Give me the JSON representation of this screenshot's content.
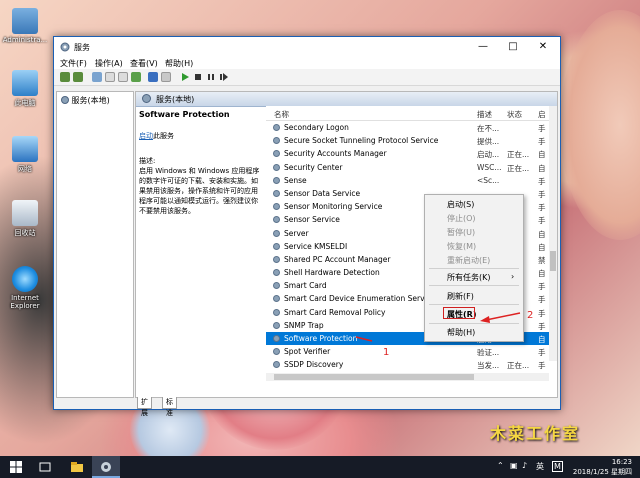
{
  "desktop": {
    "icons": [
      {
        "label": "Administra..."
      },
      {
        "label": "此电脑"
      },
      {
        "label": "网络"
      },
      {
        "label": "回收站"
      },
      {
        "label": "Internet Explorer"
      }
    ]
  },
  "window": {
    "title": "服务",
    "menu": [
      "文件(F)",
      "操作(A)",
      "查看(V)",
      "帮助(H)"
    ],
    "tree_root": "服务(本地)",
    "pane_title": "服务(本地)"
  },
  "details": {
    "service_name": "Software Protection",
    "start_link": "启动",
    "start_suffix": "此服务",
    "desc_label": "描述:",
    "desc_text": "启用 Windows 和 Windows 应用程序的数字许可证的下载、安装和实施。如果禁用该服务，操作系统和许可的应用程序可能以通知模式运行。强烈建议你不要禁用该服务。"
  },
  "columns": {
    "name": "名称",
    "desc": "描述",
    "status": "状态",
    "startup": "启"
  },
  "services": [
    {
      "name": "Secondary Logon",
      "desc": "在不...",
      "status": "",
      "startup": "手"
    },
    {
      "name": "Secure Socket Tunneling Protocol Service",
      "desc": "提供...",
      "status": "",
      "startup": "手"
    },
    {
      "name": "Security Accounts Manager",
      "desc": "启动...",
      "status": "正在...",
      "startup": "自"
    },
    {
      "name": "Security Center",
      "desc": "WSC...",
      "status": "正在...",
      "startup": "自"
    },
    {
      "name": "Sense",
      "desc": "<Sc...",
      "status": "",
      "startup": "手"
    },
    {
      "name": "Sensor Data Service",
      "desc": "",
      "status": "",
      "startup": "手"
    },
    {
      "name": "Sensor Monitoring Service",
      "desc": "",
      "status": "",
      "startup": "手"
    },
    {
      "name": "Sensor Service",
      "desc": "",
      "status": "",
      "startup": "手"
    },
    {
      "name": "Server",
      "desc": "",
      "status": "",
      "startup": "自"
    },
    {
      "name": "Service KMSELDI",
      "desc": "",
      "status": "",
      "startup": "自"
    },
    {
      "name": "Shared PC Account Manager",
      "desc": "",
      "status": "",
      "startup": "禁"
    },
    {
      "name": "Shell Hardware Detection",
      "desc": "",
      "status": "",
      "startup": "自"
    },
    {
      "name": "Smart Card",
      "desc": "",
      "status": "",
      "startup": "手"
    },
    {
      "name": "Smart Card Device Enumeration Service",
      "desc": "",
      "status": "",
      "startup": "手"
    },
    {
      "name": "Smart Card Removal Policy",
      "desc": "",
      "status": "",
      "startup": "手"
    },
    {
      "name": "SNMP Trap",
      "desc": "",
      "status": "",
      "startup": "手"
    },
    {
      "name": "Software Protection",
      "desc": "启用...",
      "status": "",
      "startup": "自"
    },
    {
      "name": "Spot Verifier",
      "desc": "验证...",
      "status": "",
      "startup": "手"
    },
    {
      "name": "SSDP Discovery",
      "desc": "当发...",
      "status": "正在...",
      "startup": "手"
    }
  ],
  "tabs": [
    "扩展",
    "标准"
  ],
  "context_menu": [
    {
      "label": "启动(S)",
      "enabled": true
    },
    {
      "label": "停止(O)",
      "enabled": false
    },
    {
      "label": "暂停(U)",
      "enabled": false
    },
    {
      "label": "恢复(M)",
      "enabled": false
    },
    {
      "label": "重新启动(E)",
      "enabled": false
    },
    {
      "label": "所有任务(K)",
      "enabled": true,
      "submenu": true
    },
    {
      "label": "刷新(F)",
      "enabled": true
    },
    {
      "label": "属性(R)",
      "enabled": true,
      "bold": true
    },
    {
      "label": "帮助(H)",
      "enabled": true
    }
  ],
  "annotations": {
    "one": "1",
    "two": "2"
  },
  "taskbar": {
    "time": "16:23",
    "date": "2018/1/25 星期四",
    "ime": "英",
    "ime2": "M"
  },
  "watermark": "木菜工作室",
  "colors": {
    "selection": "#0078d7",
    "annotation": "#d22222",
    "taskbar": "#161b26"
  }
}
